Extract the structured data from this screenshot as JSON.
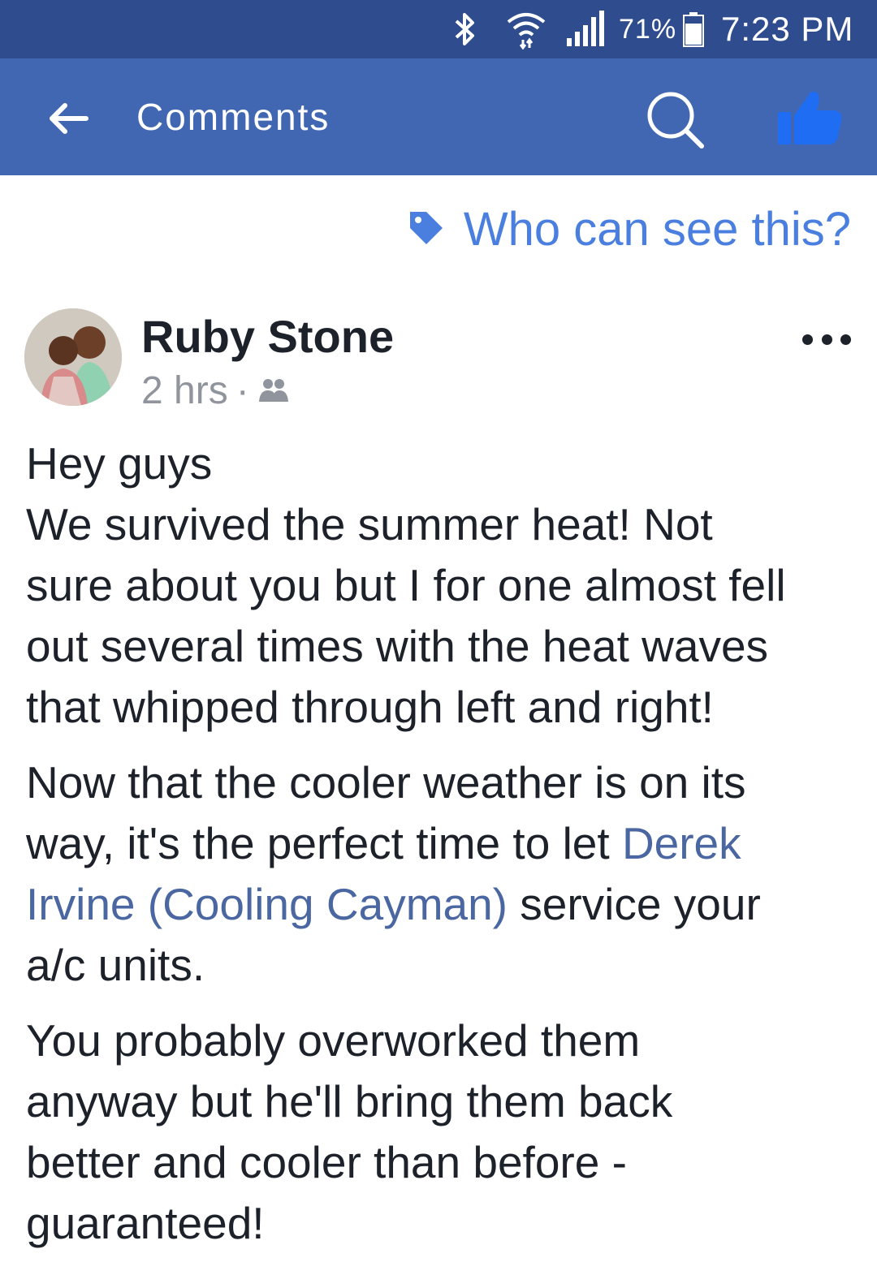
{
  "status_bar": {
    "battery_pct": "71%",
    "time": "7:23 PM",
    "icons": [
      "bluetooth-icon",
      "wifi-icon",
      "signal-icon",
      "battery-icon"
    ]
  },
  "app_bar": {
    "title": "Comments",
    "icons": [
      "back-arrow-icon",
      "search-icon",
      "like-thumb-icon"
    ]
  },
  "privacy": {
    "label": "Who can see this?",
    "icon": "tag-icon",
    "color": "#4a7fe0"
  },
  "post": {
    "author": "Ruby Stone",
    "time": "2 hrs",
    "separator": "·",
    "audience_icon": "friends-icon",
    "paragraphs": {
      "p1": {
        "l1": "Hey guys",
        "l2": "We survived the summer heat! Not",
        "l3": "sure about you but I for one almost fell",
        "l4": "out several times with the heat waves",
        "l5": "that whipped through left and right!"
      },
      "p2": {
        "l1": "Now that the cooler weather is on its",
        "l2a": "way, it's the perfect time to let ",
        "mention_a": "Derek",
        "mention_b": "Irvine (Cooling Cayman)",
        "l3b": " service your",
        "l4": "a/c units."
      },
      "p3": {
        "l1": "You probably overworked them",
        "l2": "anyway but he'll bring them back",
        "l3": "better and cooler than before -",
        "l4": "guaranteed!"
      }
    }
  },
  "colors": {
    "status_bar": "#2f4c8f",
    "app_bar": "#4267b2",
    "mention": "#4b67a1",
    "text": "#1d2129",
    "meta": "#90949c"
  }
}
